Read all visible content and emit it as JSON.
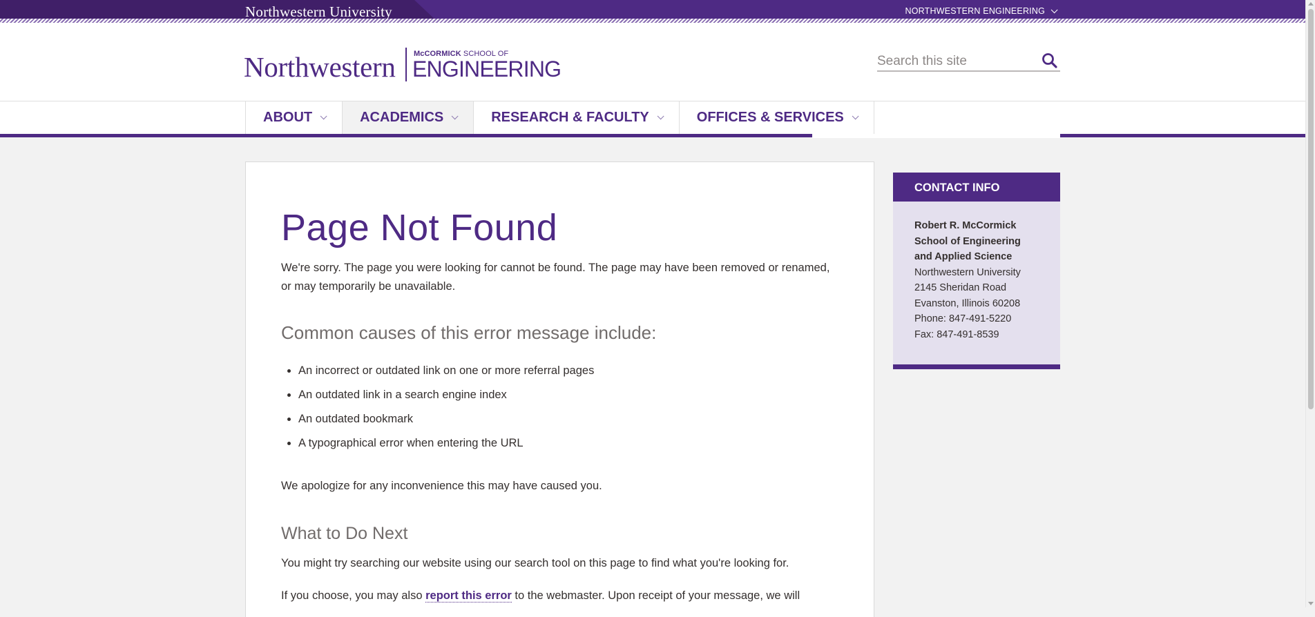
{
  "topbar": {
    "university": "Northwestern University",
    "util_link": "NORTHWESTERN ENGINEERING"
  },
  "header": {
    "logo_nu": "Northwestern",
    "logo_school_bold": "McCORMICK",
    "logo_school_rest": " SCHOOL OF",
    "logo_eng": "ENGINEERING",
    "search_placeholder": "Search this site"
  },
  "nav": {
    "items": [
      {
        "label": "ABOUT"
      },
      {
        "label": "ACADEMICS"
      },
      {
        "label": "RESEARCH & FACULTY"
      },
      {
        "label": "OFFICES & SERVICES"
      }
    ]
  },
  "main": {
    "title": "Page Not Found",
    "intro": "We're sorry. The page you were looking for cannot be found. The page may have been removed or renamed, or may temporarily be unavailable.",
    "causes_heading": "Common causes of this error message include:",
    "causes": [
      "An incorrect or outdated link on one or more referral pages",
      "An outdated link in a search engine index",
      "An outdated bookmark",
      "A typographical error when entering the URL"
    ],
    "apology": "We apologize for any inconvenience this may have caused you.",
    "next_heading": "What to Do Next",
    "try_text": "You might try searching our website using our search tool on this page to find what you're looking for.",
    "report_prefix": "If you choose, you may also ",
    "report_link": "report this error",
    "report_suffix": " to the webmaster. Upon receipt of your message, we will"
  },
  "sidebar": {
    "heading": "CONTACT INFO",
    "org": "Robert R. McCormick School of Engineering and Applied Science",
    "lines": [
      "Northwestern University",
      "2145 Sheridan Road",
      "Evanston, Illinois 60208",
      "Phone: 847-491-5220",
      "Fax: 847-491-8539"
    ]
  },
  "colors": {
    "brand_purple": "#4e2a84",
    "dark_purple": "#401f68",
    "sidebar_bg": "#e4e0ee",
    "page_bg": "#f2f2f2"
  },
  "icons": {
    "search": "search-icon",
    "dropdown": "chevron-down-icon"
  }
}
